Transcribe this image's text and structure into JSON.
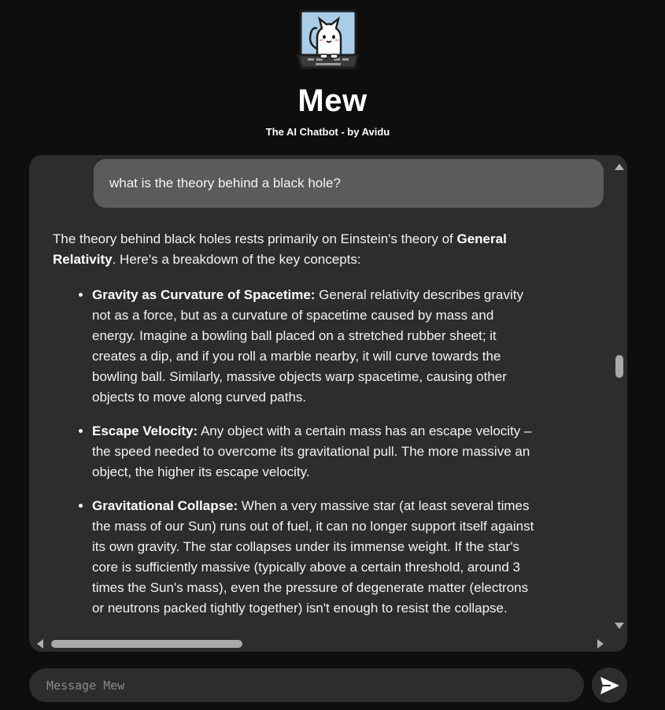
{
  "header": {
    "logo_icon": "cat-on-laptop-icon",
    "title": "Mew",
    "subtitle": "The AI Chatbot - by Avidu"
  },
  "conversation": {
    "user_message": "what is the theory behind a black hole?",
    "bot_intro": {
      "before": "The theory behind black holes rests primarily on Einstein's theory of ",
      "bold": "General Relativity",
      "after": ". Here's a breakdown of the key concepts:"
    },
    "bot_points": [
      {
        "title": "Gravity as Curvature of Spacetime:",
        "text": " General relativity describes gravity not as a force, but as a curvature of spacetime caused by mass and energy. Imagine a bowling ball placed on a stretched rubber sheet; it creates a dip, and if you roll a marble nearby, it will curve towards the bowling ball. Similarly, massive objects warp spacetime, causing other objects to move along curved paths."
      },
      {
        "title": "Escape Velocity:",
        "text": " Any object with a certain mass has an escape velocity – the speed needed to overcome its gravitational pull. The more massive an object, the higher its escape velocity."
      },
      {
        "title": "Gravitational Collapse:",
        "text": " When a very massive star (at least several times the mass of our Sun) runs out of fuel, it can no longer support itself against its own gravity. The star collapses under its immense weight. If the star's core is sufficiently massive (typically above a certain threshold, around 3 times the Sun's mass), even the pressure of degenerate matter (electrons or neutrons packed tightly together) isn't enough to resist the collapse."
      }
    ]
  },
  "composer": {
    "placeholder": "Message Mew",
    "value": "",
    "send_icon": "send-icon"
  },
  "colors": {
    "page_background": "#0e0e0e",
    "panel_background": "#2d2d2d",
    "user_bubble": "#5b5b5b",
    "text": "#f2f2f2",
    "logo_screen": "#a9cde8"
  }
}
